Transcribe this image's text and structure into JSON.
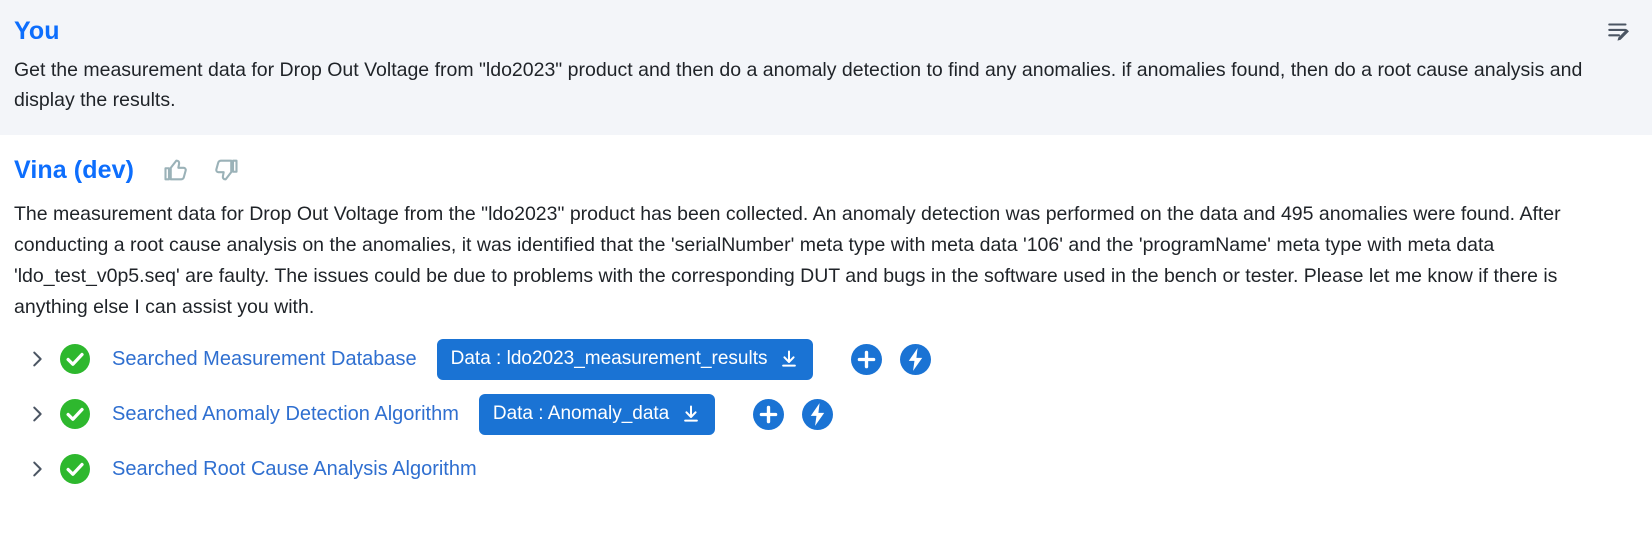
{
  "user": {
    "name": "You",
    "message": "Get the measurement data for Drop Out Voltage from \"ldo2023\" product and then do a anomaly detection to find any anomalies. if anomalies found, then do a root cause analysis and display the results.",
    "edit_icon": "edit-compose-icon"
  },
  "assistant": {
    "name": "Vina (dev)",
    "thumbs_up_icon": "thumbs-up-icon",
    "thumbs_down_icon": "thumbs-down-icon",
    "message": "The measurement data for Drop Out Voltage from the \"ldo2023\" product has been collected. An anomaly detection was performed on the data and 495 anomalies were found. After conducting a root cause analysis on the anomalies, it was identified that the 'serialNumber' meta type with meta data '106' and the 'programName' meta type with meta data 'ldo_test_v0p5.seq' are faulty. The issues could be due to problems with the corresponding DUT and bugs in the software used in the bench or tester. Please let me know if there is anything else I can assist you with."
  },
  "tool_rows": [
    {
      "expand_icon": "chevron-right-icon",
      "status_icon": "check-circle-icon",
      "label": "Searched Measurement Database",
      "chip": {
        "label": "Data : ldo2023_measurement_results",
        "icon": "download-icon"
      },
      "actions": [
        {
          "icon": "plus-icon",
          "name": "add-button"
        },
        {
          "icon": "lightning-bolt-icon",
          "name": "run-button"
        }
      ]
    },
    {
      "expand_icon": "chevron-right-icon",
      "status_icon": "check-circle-icon",
      "label": "Searched Anomaly Detection Algorithm",
      "chip": {
        "label": "Data : Anomaly_data",
        "icon": "download-icon"
      },
      "actions": [
        {
          "icon": "plus-icon",
          "name": "add-button"
        },
        {
          "icon": "lightning-bolt-icon",
          "name": "run-button"
        }
      ]
    },
    {
      "expand_icon": "chevron-right-icon",
      "status_icon": "check-circle-icon",
      "label": "Searched Root Cause Analysis Algorithm",
      "chip": null,
      "actions": []
    }
  ],
  "colors": {
    "accent_blue": "#0d6efd",
    "chip_blue": "#1a73d4",
    "link_blue": "#2f6fd0",
    "success_green": "#2eb82e",
    "user_bg": "#f3f5f9",
    "feedback_gray": "#9bb2b8"
  }
}
